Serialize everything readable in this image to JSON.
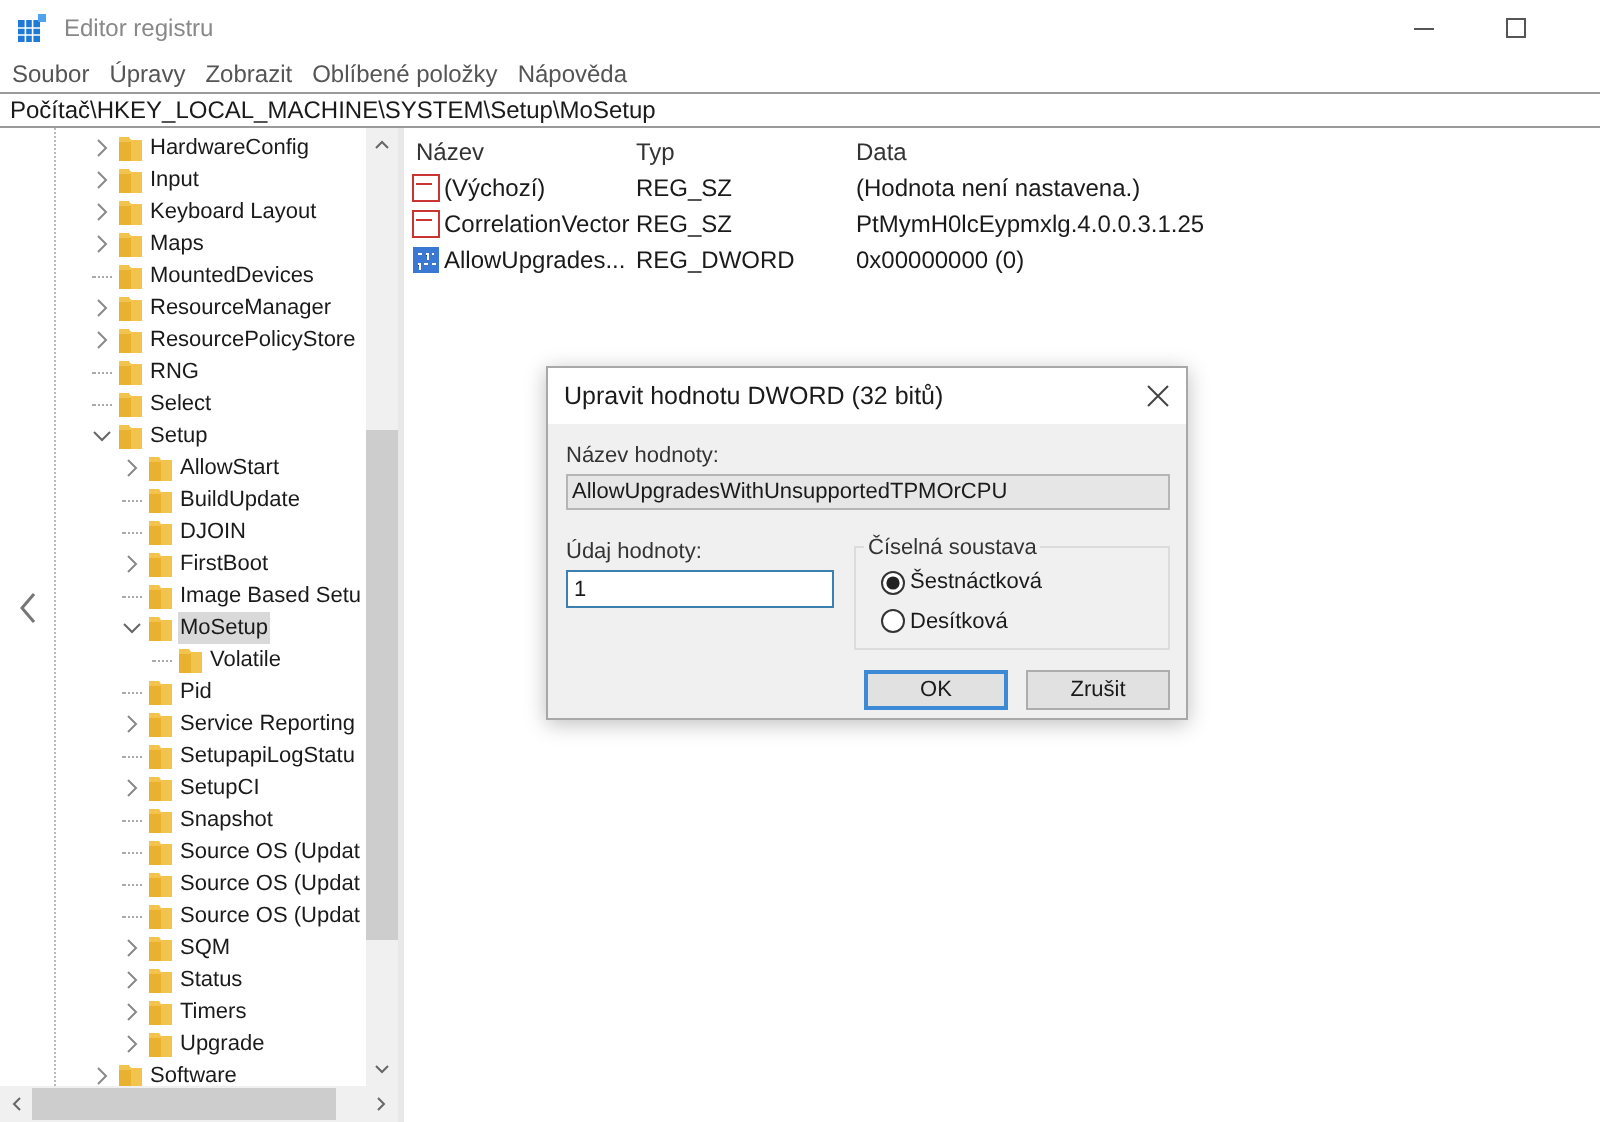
{
  "window": {
    "title": "Editor registru"
  },
  "menu": [
    "Soubor",
    "Úpravy",
    "Zobrazit",
    "Oblíbené položky",
    "Nápověda"
  ],
  "address": "Počítač\\HKEY_LOCAL_MACHINE\\SYSTEM\\Setup\\MoSetup",
  "tree": [
    {
      "label": "HardwareConfig",
      "kind": "collapsed",
      "selected": false
    },
    {
      "label": "Input",
      "kind": "collapsed",
      "selected": false
    },
    {
      "label": "Keyboard Layout",
      "kind": "collapsed",
      "selected": false
    },
    {
      "label": "Maps",
      "kind": "collapsed",
      "selected": false
    },
    {
      "label": "MountedDevices",
      "kind": "leaf",
      "selected": false
    },
    {
      "label": "ResourceManager",
      "kind": "collapsed",
      "selected": false
    },
    {
      "label": "ResourcePolicyStore",
      "kind": "collapsed",
      "selected": false
    },
    {
      "label": "RNG",
      "kind": "leaf",
      "selected": false
    },
    {
      "label": "Select",
      "kind": "leaf",
      "selected": false
    },
    {
      "label": "Setup",
      "kind": "expanded",
      "selected": false,
      "children": [
        {
          "label": "AllowStart",
          "kind": "collapsed",
          "selected": false
        },
        {
          "label": "BuildUpdate",
          "kind": "leaf",
          "selected": false
        },
        {
          "label": "DJOIN",
          "kind": "leaf",
          "selected": false
        },
        {
          "label": "FirstBoot",
          "kind": "collapsed",
          "selected": false
        },
        {
          "label": "Image Based Setu",
          "kind": "leaf",
          "selected": false
        },
        {
          "label": "MoSetup",
          "kind": "expanded",
          "selected": true,
          "children": [
            {
              "label": "Volatile",
              "kind": "leaf",
              "selected": false
            }
          ]
        },
        {
          "label": "Pid",
          "kind": "leaf",
          "selected": false
        },
        {
          "label": "Service Reporting",
          "kind": "collapsed",
          "selected": false
        },
        {
          "label": "SetupapiLogStatu",
          "kind": "leaf",
          "selected": false
        },
        {
          "label": "SetupCI",
          "kind": "collapsed",
          "selected": false
        },
        {
          "label": "Snapshot",
          "kind": "leaf",
          "selected": false
        },
        {
          "label": "Source OS (Updat",
          "kind": "leaf",
          "selected": false
        },
        {
          "label": "Source OS (Updat",
          "kind": "leaf",
          "selected": false
        },
        {
          "label": "Source OS (Updat",
          "kind": "leaf",
          "selected": false
        },
        {
          "label": "SQM",
          "kind": "collapsed",
          "selected": false
        },
        {
          "label": "Status",
          "kind": "collapsed",
          "selected": false
        },
        {
          "label": "Timers",
          "kind": "collapsed",
          "selected": false
        },
        {
          "label": "Upgrade",
          "kind": "collapsed",
          "selected": false
        }
      ]
    },
    {
      "label": "Software",
      "kind": "collapsed",
      "selected": false
    }
  ],
  "values": {
    "columns": [
      "Název",
      "Typ",
      "Data"
    ],
    "rows": [
      {
        "name": "(Výchozí)",
        "type": "REG_SZ",
        "data": "(Hodnota není nastavena.)",
        "kind": "string"
      },
      {
        "name": "CorrelationVector",
        "type": "REG_SZ",
        "data": "PtMymH0lcEypmxlg.4.0.0.3.1.25",
        "kind": "string"
      },
      {
        "name": "AllowUpgrades...",
        "type": "REG_DWORD",
        "data": "0x00000000 (0)",
        "kind": "binary"
      }
    ]
  },
  "dialog": {
    "title": "Upravit hodnotu DWORD (32 bitů)",
    "value_name_label": "Název hodnoty:",
    "value_name": "AllowUpgradesWithUnsupportedTPMOrCPU",
    "value_data_label": "Údaj hodnoty:",
    "value_data": "1",
    "base_title": "Číselná soustava",
    "bases": [
      {
        "label": "Šestnáctková",
        "selected": true
      },
      {
        "label": "Desítková",
        "selected": false
      }
    ],
    "buttons": [
      {
        "label": "OK",
        "default": true
      },
      {
        "label": "Zrušit",
        "default": false
      }
    ]
  }
}
